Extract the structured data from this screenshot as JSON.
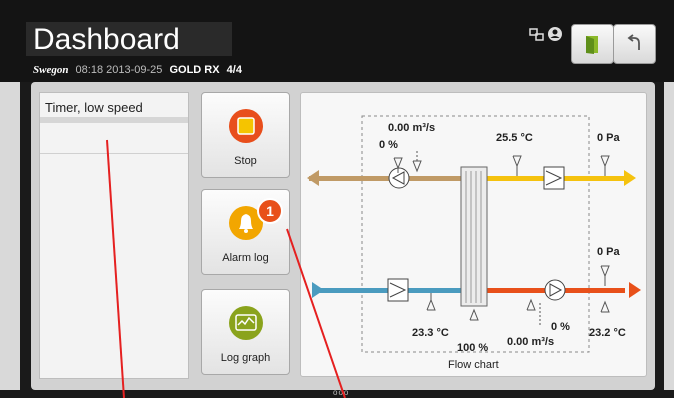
{
  "header": {
    "title": "Dashboard",
    "brand": "Swegon",
    "datetime": "08:18 2013-09-25",
    "unit": "GOLD RX",
    "page": "4/4"
  },
  "status_icons": [
    "network-icon",
    "user-icon"
  ],
  "toolbar": {
    "buttons": [
      {
        "name": "door-exit-button",
        "icon": "door-icon"
      },
      {
        "name": "back-button",
        "icon": "return-arrow-icon"
      }
    ]
  },
  "list": {
    "items": [
      "Timer, low speed"
    ]
  },
  "tiles": [
    {
      "label": "Stop",
      "icon": "stop-icon",
      "color": "#e84e1b"
    },
    {
      "label": "Alarm log",
      "icon": "bell-icon",
      "color": "#f2a600",
      "badge": "1"
    },
    {
      "label": "Log graph",
      "icon": "graph-icon",
      "color": "#8aa31c"
    }
  ],
  "flow_chart": {
    "title": "Flow chart",
    "exhaust_flow": "0.00 m³/s",
    "exhaust_fan_pct": "0 %",
    "extract_temp": "25.5 °C",
    "extract_pressure": "0 Pa",
    "supply_pressure": "0 Pa",
    "outdoor_temp": "23.3 °C",
    "rotor_pct": "100 %",
    "supply_fan_pct": "0 %",
    "supply_flow": "0.00 m³/s",
    "supply_temp": "23.2 °C"
  },
  "colors": {
    "exhaust_brown": "#c09a66",
    "extract_yellow": "#f5c20e",
    "outdoor_blue": "#4a9bbf",
    "supply_orange": "#e8501a"
  },
  "pager": "ooo"
}
